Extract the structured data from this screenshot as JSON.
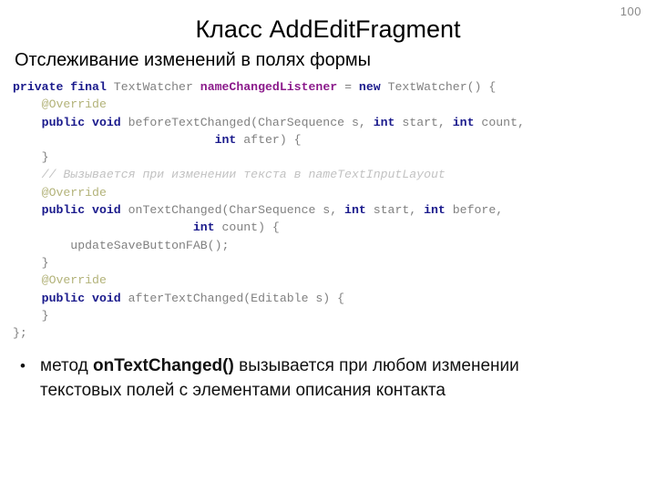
{
  "slide": {
    "number": "100",
    "title": "Класс AddEditFragment",
    "subtitle": "Отслеживание изменений в полях формы"
  },
  "code": {
    "lines": [
      {
        "id": "line-1",
        "tokens": [
          {
            "t": "private final",
            "c": "kw"
          },
          {
            "t": " TextWatcher ",
            "c": "plain"
          },
          {
            "t": "nameChangedListener",
            "c": "ident"
          },
          {
            "t": " = ",
            "c": "plain"
          },
          {
            "t": "new",
            "c": "kw"
          },
          {
            "t": " TextWatcher() {",
            "c": "plain"
          }
        ]
      },
      {
        "id": "line-2",
        "tokens": [
          {
            "t": "    @Override",
            "c": "anno"
          }
        ]
      },
      {
        "id": "line-3",
        "tokens": [
          {
            "t": "    ",
            "c": "plain"
          },
          {
            "t": "public void",
            "c": "kw"
          },
          {
            "t": " beforeTextChanged(CharSequence s, ",
            "c": "plain"
          },
          {
            "t": "int",
            "c": "kw"
          },
          {
            "t": " start, ",
            "c": "plain"
          },
          {
            "t": "int",
            "c": "kw"
          },
          {
            "t": " count,",
            "c": "plain"
          }
        ]
      },
      {
        "id": "line-4",
        "tokens": [
          {
            "t": "                            ",
            "c": "plain"
          },
          {
            "t": "int",
            "c": "kw"
          },
          {
            "t": " after) {",
            "c": "plain"
          }
        ]
      },
      {
        "id": "line-5",
        "tokens": [
          {
            "t": "    }",
            "c": "plain"
          }
        ]
      },
      {
        "id": "line-6",
        "tokens": [
          {
            "t": "    // Вызывается при изменении текста в nameTextInputLayout",
            "c": "comment"
          }
        ]
      },
      {
        "id": "line-7",
        "tokens": [
          {
            "t": "    @Override",
            "c": "anno"
          }
        ]
      },
      {
        "id": "line-8",
        "tokens": [
          {
            "t": "    ",
            "c": "plain"
          },
          {
            "t": "public void",
            "c": "kw"
          },
          {
            "t": " onTextChanged(CharSequence s, ",
            "c": "plain"
          },
          {
            "t": "int",
            "c": "kw"
          },
          {
            "t": " start, ",
            "c": "plain"
          },
          {
            "t": "int",
            "c": "kw"
          },
          {
            "t": " before,",
            "c": "plain"
          }
        ]
      },
      {
        "id": "line-9",
        "tokens": [
          {
            "t": "                         ",
            "c": "plain"
          },
          {
            "t": "int",
            "c": "kw"
          },
          {
            "t": " count) {",
            "c": "plain"
          }
        ]
      },
      {
        "id": "line-10",
        "tokens": [
          {
            "t": "        updateSaveButtonFAB();",
            "c": "plain"
          }
        ]
      },
      {
        "id": "line-11",
        "tokens": [
          {
            "t": "    }",
            "c": "plain"
          }
        ]
      },
      {
        "id": "line-12",
        "tokens": [
          {
            "t": "    @Override",
            "c": "anno"
          }
        ]
      },
      {
        "id": "line-13",
        "tokens": [
          {
            "t": "    ",
            "c": "plain"
          },
          {
            "t": "public void",
            "c": "kw"
          },
          {
            "t": " afterTextChanged(Editable s) {",
            "c": "plain"
          }
        ]
      },
      {
        "id": "line-14",
        "tokens": [
          {
            "t": "    }",
            "c": "plain"
          }
        ]
      },
      {
        "id": "line-15",
        "tokens": [
          {
            "t": "};",
            "c": "plain"
          }
        ]
      }
    ],
    "colors": {
      "keyword": "#1a1a8c",
      "identifier": "#8b1a8b",
      "plain": "#808080",
      "annotation": "#b3b37a",
      "comment": "#c2c2c2"
    }
  },
  "bullets": {
    "marker": "•",
    "items": [
      {
        "id": "bullet-1",
        "parts": [
          {
            "t": "метод ",
            "bold": false
          },
          {
            "t": "onTextChanged()",
            "bold": true
          },
          {
            "t": " вызывается при любом изменении текстовых  полей с элементами описания контакта",
            "bold": false
          }
        ]
      }
    ]
  }
}
